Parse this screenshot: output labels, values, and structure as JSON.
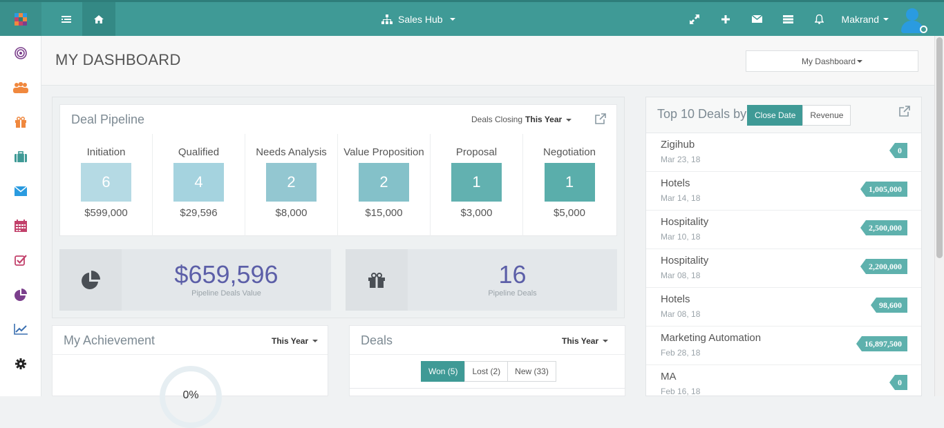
{
  "topbar": {
    "hub_label": "Sales Hub",
    "user_name": "Makrand",
    "icons": [
      "menu-icon",
      "home-icon",
      "sitemap-icon",
      "expand-icon",
      "plus-icon",
      "envelope-icon",
      "list-icon",
      "bell-icon"
    ]
  },
  "sidebar": {
    "items": [
      "target-icon",
      "users-icon",
      "gift-icon",
      "briefcase-icon",
      "envelope-icon",
      "calendar-icon",
      "checkbox-icon",
      "pie-chart-icon",
      "line-chart-icon",
      "gear-icon"
    ],
    "colors": [
      "#7b3f8c",
      "#f0883e",
      "#f0883e",
      "#3f9a96",
      "#2a9be0",
      "#c2416b",
      "#c2416b",
      "#7b3f8c",
      "#3a6fb0",
      "#222222"
    ]
  },
  "header": {
    "title": "MY DASHBOARD",
    "dashboard_select": "My Dashboard"
  },
  "pipeline": {
    "title": "Deal Pipeline",
    "closing_label": "Deals Closing",
    "closing_value": "This Year",
    "stages": [
      {
        "name": "Initiation",
        "count": "6",
        "amount": "$599,000",
        "color": "#b5dae4"
      },
      {
        "name": "Qualified",
        "count": "4",
        "amount": "$29,596",
        "color": "#a5d3df"
      },
      {
        "name": "Needs Analysis",
        "count": "2",
        "amount": "$8,000",
        "color": "#93c7d1"
      },
      {
        "name": "Value Proposition",
        "count": "2",
        "amount": "$15,000",
        "color": "#84c1c9"
      },
      {
        "name": "Proposal",
        "count": "1",
        "amount": "$3,000",
        "color": "#62b1b0"
      },
      {
        "name": "Negotiation",
        "count": "1",
        "amount": "$5,000",
        "color": "#5aaeab"
      }
    ],
    "value_total": "$659,596",
    "value_label": "Pipeline Deals Value",
    "deals_total": "16",
    "deals_label": "Pipeline Deals"
  },
  "achievement": {
    "title": "My Achievement",
    "period": "This Year",
    "percent": "0%"
  },
  "deals": {
    "title": "Deals",
    "period": "This Year",
    "tabs": [
      "Won (5)",
      "Lost (2)",
      "New (33)"
    ]
  },
  "top10": {
    "title": "Top 10 Deals by",
    "segments": [
      "Close Date",
      "Revenue"
    ],
    "items": [
      {
        "name": "Zigihub",
        "date": "Mar 23, 18",
        "value": "0"
      },
      {
        "name": "Hotels",
        "date": "Mar 14, 18",
        "value": "1,005,000"
      },
      {
        "name": "Hospitality",
        "date": "Mar 10, 18",
        "value": "2,500,000"
      },
      {
        "name": "Hospitality",
        "date": "Mar 08, 18",
        "value": "2,200,000"
      },
      {
        "name": "Hotels",
        "date": "Mar 08, 18",
        "value": "98,600"
      },
      {
        "name": "Marketing Automation",
        "date": "Feb 28, 18",
        "value": "16,897,500"
      },
      {
        "name": "MA",
        "date": "Feb 16, 18",
        "value": "0"
      }
    ]
  }
}
